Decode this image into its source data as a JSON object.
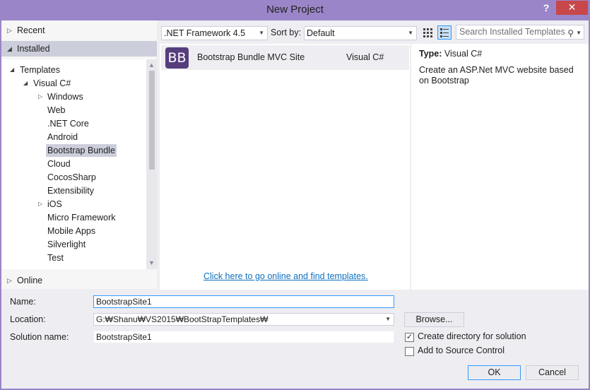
{
  "window": {
    "title": "New Project",
    "help_label": "?",
    "close_label": "✕"
  },
  "left_panel": {
    "recent_label": "Recent",
    "installed_label": "Installed",
    "online_label": "Online",
    "tree": {
      "templates_label": "Templates",
      "visual_csharp_label": "Visual C#",
      "items": [
        "Windows",
        "Web",
        ".NET Core",
        "Android",
        "Bootstrap Bundle",
        "Cloud",
        "CocosSharp",
        "Extensibility",
        "iOS",
        "Micro Framework",
        "Mobile Apps",
        "Silverlight",
        "Test"
      ],
      "selected": "Bootstrap Bundle"
    }
  },
  "toolbar": {
    "framework_value": ".NET Framework 4.5",
    "sort_by_label": "Sort by:",
    "sort_value": "Default",
    "search_placeholder": "Search Installed Templates"
  },
  "templates": [
    {
      "icon_text": "BB",
      "name": "Bootstrap Bundle MVC Site",
      "language": "Visual C#"
    }
  ],
  "online_link": "Click here to go online and find templates.",
  "details": {
    "type_label": "Type:",
    "type_value": "Visual C#",
    "description": "Create an ASP.Net MVC website based on Bootstrap"
  },
  "form": {
    "name_label": "Name:",
    "name_value": "BootstrapSite1",
    "location_label": "Location:",
    "location_value": "G:₩Shanu₩VS2015₩BootStrapTemplates₩",
    "solution_label": "Solution name:",
    "solution_value": "BootstrapSite1",
    "browse_label": "Browse...",
    "create_dir_label": "Create directory for solution",
    "create_dir_checked": true,
    "source_control_label": "Add to Source Control",
    "source_control_checked": false,
    "ok_label": "OK",
    "cancel_label": "Cancel"
  },
  "colors": {
    "title_bar": "#9a85c8",
    "close_button": "#c7474b",
    "bootstrap_icon": "#563d7c",
    "selection": "#cccedb",
    "link": "#0e70c0"
  }
}
